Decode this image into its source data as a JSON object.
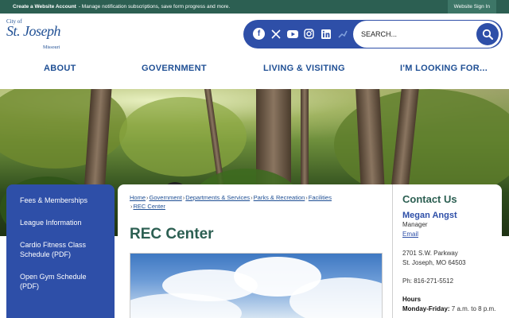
{
  "topbar": {
    "create_account": "Create a Website Account",
    "create_account_desc": "- Manage notification subscriptions, save form progress and more.",
    "sign_in": "Website Sign In"
  },
  "logo": {
    "city": "City of",
    "name": "St. Joseph",
    "state": "Missouri"
  },
  "social": [
    "facebook-icon",
    "x-icon",
    "youtube-icon",
    "instagram-icon",
    "linkedin-icon",
    "nextdoor-icon"
  ],
  "search": {
    "placeholder": "SEARCH..."
  },
  "nav": {
    "items": [
      "ABOUT",
      "GOVERNMENT",
      "LIVING & VISITING",
      "I'M LOOKING FOR..."
    ]
  },
  "sidebar": {
    "items": [
      {
        "label": "Fees & Memberships"
      },
      {
        "label": "League Information"
      },
      {
        "label": "Cardio Fitness Class Schedule (PDF)"
      },
      {
        "label": "Open Gym Schedule (PDF)"
      }
    ]
  },
  "breadcrumb": {
    "items": [
      "Home",
      "Government",
      "Departments & Services",
      "Parks & Recreation",
      "Facilities",
      "REC Center"
    ]
  },
  "page_title": "REC Center",
  "contact": {
    "title": "Contact Us",
    "name": "Megan Angst",
    "role": "Manager",
    "email": "Email",
    "address1": "2701 S.W. Parkway",
    "address2": "St. Joseph, MO 64503",
    "phone": "Ph: 816-271-5512",
    "hours_heading": "Hours",
    "hours_days": "Monday-Friday:",
    "hours_time": "7 a.m. to 8 p.m."
  },
  "colors": {
    "topbar": "#2c5f52",
    "brand_blue": "#2e4fa8",
    "heading_green": "#2c5f52"
  }
}
